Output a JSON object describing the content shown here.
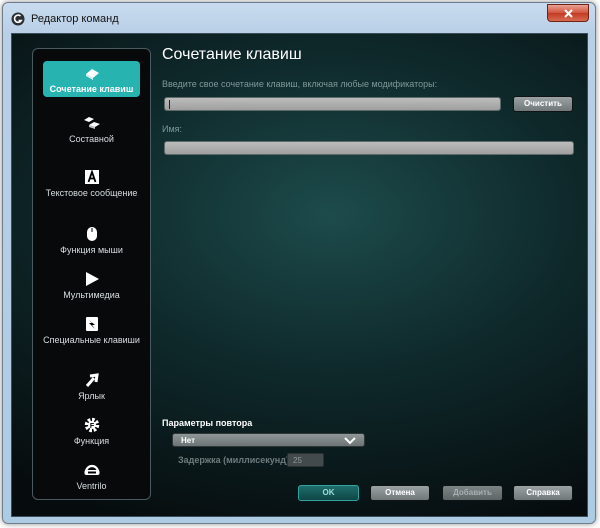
{
  "window": {
    "title": "Редактор команд",
    "close_symbol": "×"
  },
  "sidebar": {
    "items": [
      {
        "label": "Сочетание клавиш",
        "icon": "key-icon",
        "active": true
      },
      {
        "label": "Составной",
        "icon": "multi-key-icon",
        "active": false
      },
      {
        "label": "Текстовое сообщение",
        "icon": "text-a-icon",
        "active": false
      },
      {
        "label": "Функция мыши",
        "icon": "mouse-icon",
        "active": false
      },
      {
        "label": "Мультимедиа",
        "icon": "play-icon",
        "active": false
      },
      {
        "label": "Специальные клавиши",
        "icon": "special-key-icon",
        "active": false
      },
      {
        "label": "Ярлык",
        "icon": "shortcut-arrow-icon",
        "active": false
      },
      {
        "label": "Функция",
        "icon": "gear-icon",
        "active": false
      },
      {
        "label": "Ventrilo",
        "icon": "headset-icon",
        "active": false
      }
    ]
  },
  "main": {
    "heading": "Сочетание клавиш",
    "keystroke_prompt": "Введите свое сочетание клавиш, включая любые модификаторы:",
    "keystroke_value": "",
    "clear_label": "Очистить",
    "name_label": "Имя:",
    "name_value": ""
  },
  "repeat": {
    "label": "Параметры повтора",
    "selected": "Нет",
    "delay_label": "Задержка (миллисекунд):",
    "delay_value": "25"
  },
  "footer": {
    "ok": "OK",
    "cancel": "Отмена",
    "add": "Добавить",
    "help": "Справка"
  },
  "colors": {
    "accent": "#27b3b0",
    "background_center": "#1d4b4b",
    "background_edge": "#060b0d"
  }
}
